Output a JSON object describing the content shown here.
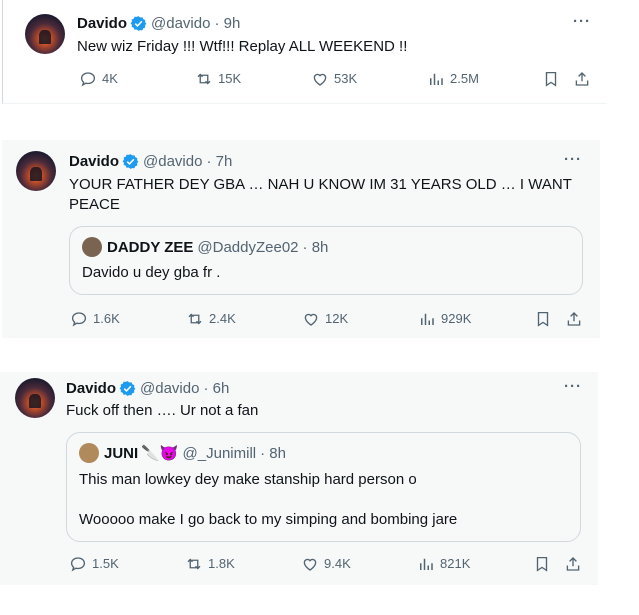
{
  "tweets": [
    {
      "name": "Davido",
      "handle": "@davido",
      "time": "· 9h",
      "text": "New wiz Friday !!! Wtf!!! Replay ALL WEEKEND !!",
      "stats": {
        "replies": "4K",
        "reposts": "15K",
        "likes": "53K",
        "views": "2.5M"
      }
    },
    {
      "name": "Davido",
      "handle": "@davido",
      "time": "· 7h",
      "text_line1": "YOUR FATHER DEY GBA … NAH U KNOW IM 31 YEARS OLD … I WANT",
      "text_line2": "PEACE",
      "quote": {
        "name": "DADDY ZEE",
        "handle": "@DaddyZee02",
        "time": "· 8h",
        "text": "Davido u dey gba fr ."
      },
      "stats": {
        "replies": "1.6K",
        "reposts": "2.4K",
        "likes": "12K",
        "views": "929K"
      }
    },
    {
      "name": "Davido",
      "handle": "@davido",
      "time": "· 6h",
      "text": "Fuck off then …. Ur not a fan",
      "quote": {
        "name": "JUNI",
        "name_emoji": "🔪😈",
        "handle": "@_Junimill",
        "time": "· 8h",
        "text_line1": "This man lowkey dey make stanship hard person o",
        "text_line2": "Wooooo make I go back to my simping and bombing jare"
      },
      "stats": {
        "replies": "1.5K",
        "reposts": "1.8K",
        "likes": "9.4K",
        "views": "821K"
      }
    }
  ],
  "more_label": "···",
  "colors": {
    "accent": "#1d9bf0",
    "secondary_text": "#536471",
    "primary_text": "#0f1419"
  }
}
